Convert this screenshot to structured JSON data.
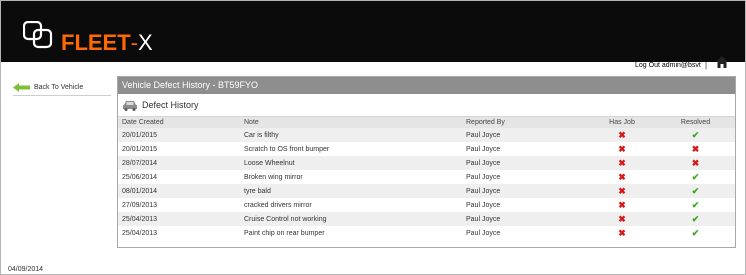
{
  "brand": {
    "name_fleet": "FLEET",
    "name_dash": "-",
    "name_x": "X",
    "accent": "#ff6a00"
  },
  "header": {
    "logout_label": "Log Out admin@bsvt",
    "separator": "|",
    "home_icon": "home-icon"
  },
  "sidebar": {
    "back_label": "Back To Vehicle",
    "back_icon": "green-arrow-left-icon"
  },
  "panel": {
    "title": "Vehicle Defect History - BT59FYO",
    "section_title": "Defect History",
    "section_icon": "car-icon"
  },
  "table": {
    "columns": {
      "date": "Date Created",
      "note": "Note",
      "reported_by": "Reported By",
      "has_job": "Has Job",
      "resolved": "Resolved"
    },
    "rows": [
      {
        "date": "20/01/2015",
        "note": "Car is filthy",
        "reported_by": "Paul Joyce",
        "has_job": "✖",
        "resolved": "✔"
      },
      {
        "date": "20/01/2015",
        "note": "Scratch to OS front bumper",
        "reported_by": "Paul Joyce",
        "has_job": "✖",
        "resolved": "✖"
      },
      {
        "date": "28/07/2014",
        "note": "Loose Wheelnut",
        "reported_by": "Paul Joyce",
        "has_job": "✖",
        "resolved": "✖"
      },
      {
        "date": "25/06/2014",
        "note": "Broken wing mirror",
        "reported_by": "Paul Joyce",
        "has_job": "✖",
        "resolved": "✔"
      },
      {
        "date": "08/01/2014",
        "note": "tyre bald",
        "reported_by": "Paul Joyce",
        "has_job": "✖",
        "resolved": "✔"
      },
      {
        "date": "27/09/2013",
        "note": "cracked drivers mirror",
        "reported_by": "Paul Joyce",
        "has_job": "✖",
        "resolved": "✔"
      },
      {
        "date": "25/04/2013",
        "note": "Cruise Control not working",
        "reported_by": "Paul Joyce",
        "has_job": "✖",
        "resolved": "✔"
      },
      {
        "date": "25/04/2013",
        "note": "Paint chip on rear bumper",
        "reported_by": "Paul Joyce",
        "has_job": "✖",
        "resolved": "✔"
      }
    ]
  },
  "footer": {
    "date": "04/09/2014"
  },
  "colors": {
    "topbar": "#0b0b0b",
    "panel_title_bg": "#8e8e8e",
    "cross": "#d51919",
    "check": "#3aa91f"
  }
}
